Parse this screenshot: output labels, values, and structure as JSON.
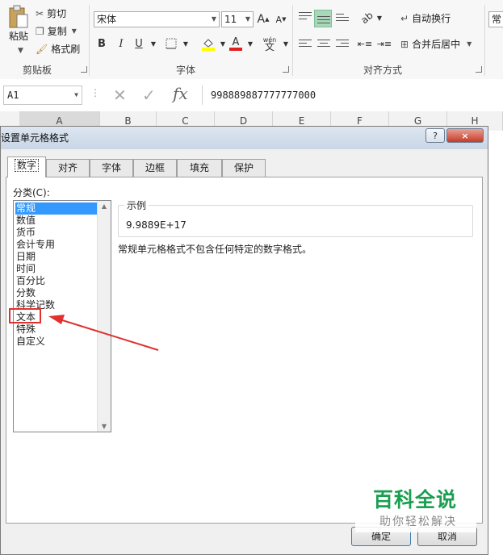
{
  "ribbon": {
    "clipboard": {
      "paste_label": "粘贴",
      "cut_label": "剪切",
      "copy_label": "复制",
      "format_painter_label": "格式刷",
      "group_label": "剪贴板"
    },
    "font": {
      "font_name": "宋体",
      "font_size": "11",
      "grow_font": "A",
      "shrink_font": "A",
      "bold": "B",
      "italic": "I",
      "underline": "U",
      "phonetic_label": "wén",
      "group_label": "字体"
    },
    "alignment": {
      "wrap_text_label": "自动换行",
      "merge_center_label": "合并后居中",
      "group_label": "对齐方式"
    },
    "number": {
      "format_partial": "常"
    }
  },
  "formula_bar": {
    "name_box": "A1",
    "fx_label": "fx",
    "value": "998889887777777000"
  },
  "columns": [
    "A",
    "B",
    "C",
    "D",
    "E",
    "F",
    "G",
    "H"
  ],
  "dialog": {
    "title": "设置单元格格式",
    "help_label": "?",
    "close_label": "×",
    "tabs": [
      "数字",
      "对齐",
      "字体",
      "边框",
      "填充",
      "保护"
    ],
    "active_tab": "数字",
    "category_label": "分类(C):",
    "categories": [
      "常规",
      "数值",
      "货币",
      "会计专用",
      "日期",
      "时间",
      "百分比",
      "分数",
      "科学记数",
      "文本",
      "特殊",
      "自定义"
    ],
    "selected_category": "常规",
    "sample_legend": "示例",
    "sample_value": "9.9889E+17",
    "description": "常规单元格格式不包含任何特定的数字格式。",
    "ok_label": "确定",
    "cancel_label": "取消"
  },
  "annotation": {
    "highlighted_item": "文本",
    "arrow_color": "#e0312f"
  },
  "watermark": {
    "title": "百科全说",
    "subtitle": "助你轻松解决"
  }
}
